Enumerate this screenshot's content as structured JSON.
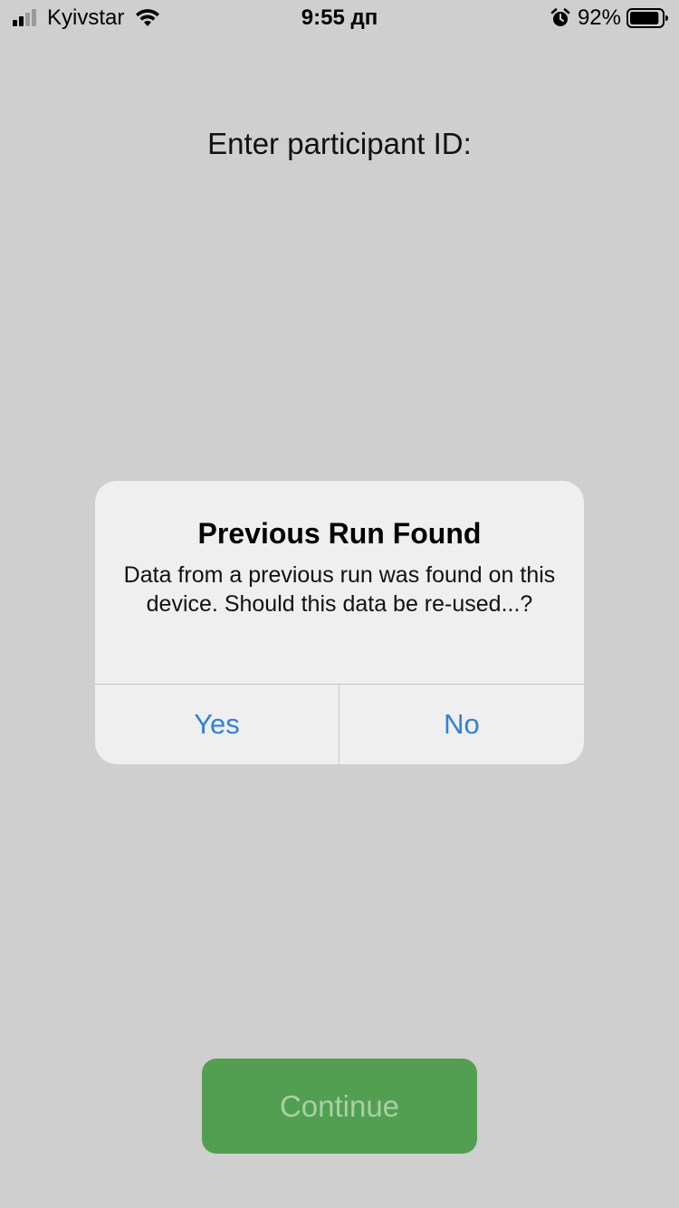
{
  "status_bar": {
    "carrier": "Kyivstar",
    "time": "9:55 дп",
    "battery_percent": "92%",
    "battery_level": 0.92,
    "signal_bars_active": 2,
    "signal_bars_total": 4,
    "icons": [
      "signal-icon",
      "wifi-icon",
      "alarm-icon",
      "battery-icon"
    ]
  },
  "main": {
    "prompt": "Enter participant ID:",
    "continue_label": "Continue"
  },
  "alert": {
    "title": "Previous Run Found",
    "message": "Data from a previous run was found on this device. Should this data be re-used...?",
    "yes_label": "Yes",
    "no_label": "No"
  },
  "colors": {
    "background": "#cfcfcf",
    "alert_background": "#efefef",
    "action_blue": "#2f7fe0",
    "continue_green": "#539f51",
    "continue_text": "#a9cfa6"
  }
}
